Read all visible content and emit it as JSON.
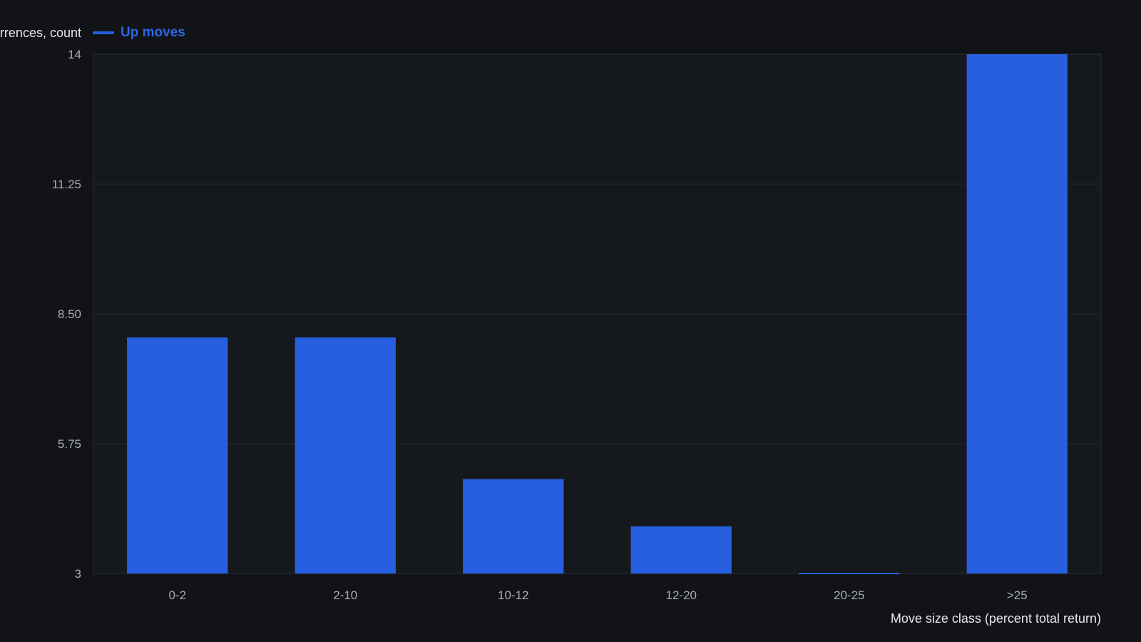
{
  "chart_data": {
    "type": "bar",
    "ylabel": "Occurrences, count",
    "xlabel": "Move size class (percent total return)",
    "categories": [
      "0-2",
      "2-10",
      "10-12",
      "12-20",
      "20-25",
      ">25"
    ],
    "series": [
      {
        "name": "Up moves",
        "values": [
          8,
          8,
          5,
          4,
          3,
          14
        ]
      }
    ],
    "ylim": [
      3,
      14
    ],
    "yticks": [
      "3",
      "5.75",
      "8.50",
      "11.25",
      "14"
    ],
    "grid": true,
    "legend_position": "top-left",
    "colors": {
      "background": "#111317",
      "plot_background": "#15181c",
      "bar": "#2660e0",
      "legend_text": "#2d66e6",
      "grid": "#23262c",
      "axis_text": "#a9adb4",
      "label_text": "#e6e8eb"
    }
  }
}
